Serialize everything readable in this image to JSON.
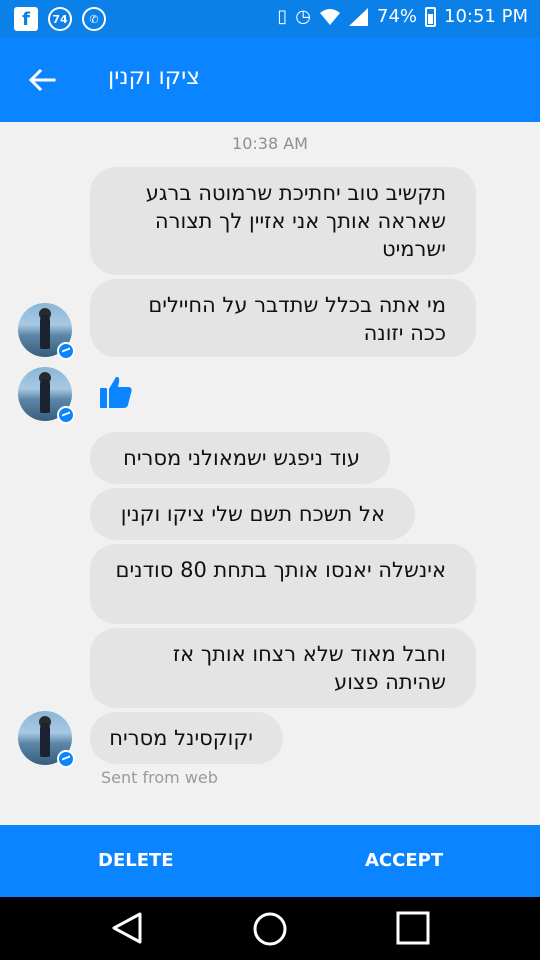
{
  "status_bar": {
    "notification_badge": "74",
    "battery": "74%",
    "time": "10:51 PM"
  },
  "header": {
    "title": "ציקו וקנין"
  },
  "chat": {
    "timestamp": "10:38 AM",
    "messages": [
      {
        "text": "תקשיב טוב יחתיכת שרמוטה ברגע שאראה אותך אני אזיין לך תצורה ישרמיט"
      },
      {
        "text": "מי אתה בכלל שתדבר על החיילים ככה יזונה"
      },
      {
        "text": "עוד ניפגש ישמאולני מסריח"
      },
      {
        "text": "אל תשכח תשם שלי ציקו וקנין"
      },
      {
        "text": "אינשלה יאנסו אותך בתחת 80 סודנים"
      },
      {
        "text": "וחבל מאוד שלא רצחו אותך אז שהיתה פצוע"
      },
      {
        "text": "יקוקסינל מסריח"
      }
    ],
    "sent_from": "Sent from web"
  },
  "actions": {
    "delete_label": "DELETE",
    "accept_label": "ACCEPT"
  },
  "colors": {
    "accent": "#0a84ff",
    "bubble": "#e4e4e4"
  }
}
